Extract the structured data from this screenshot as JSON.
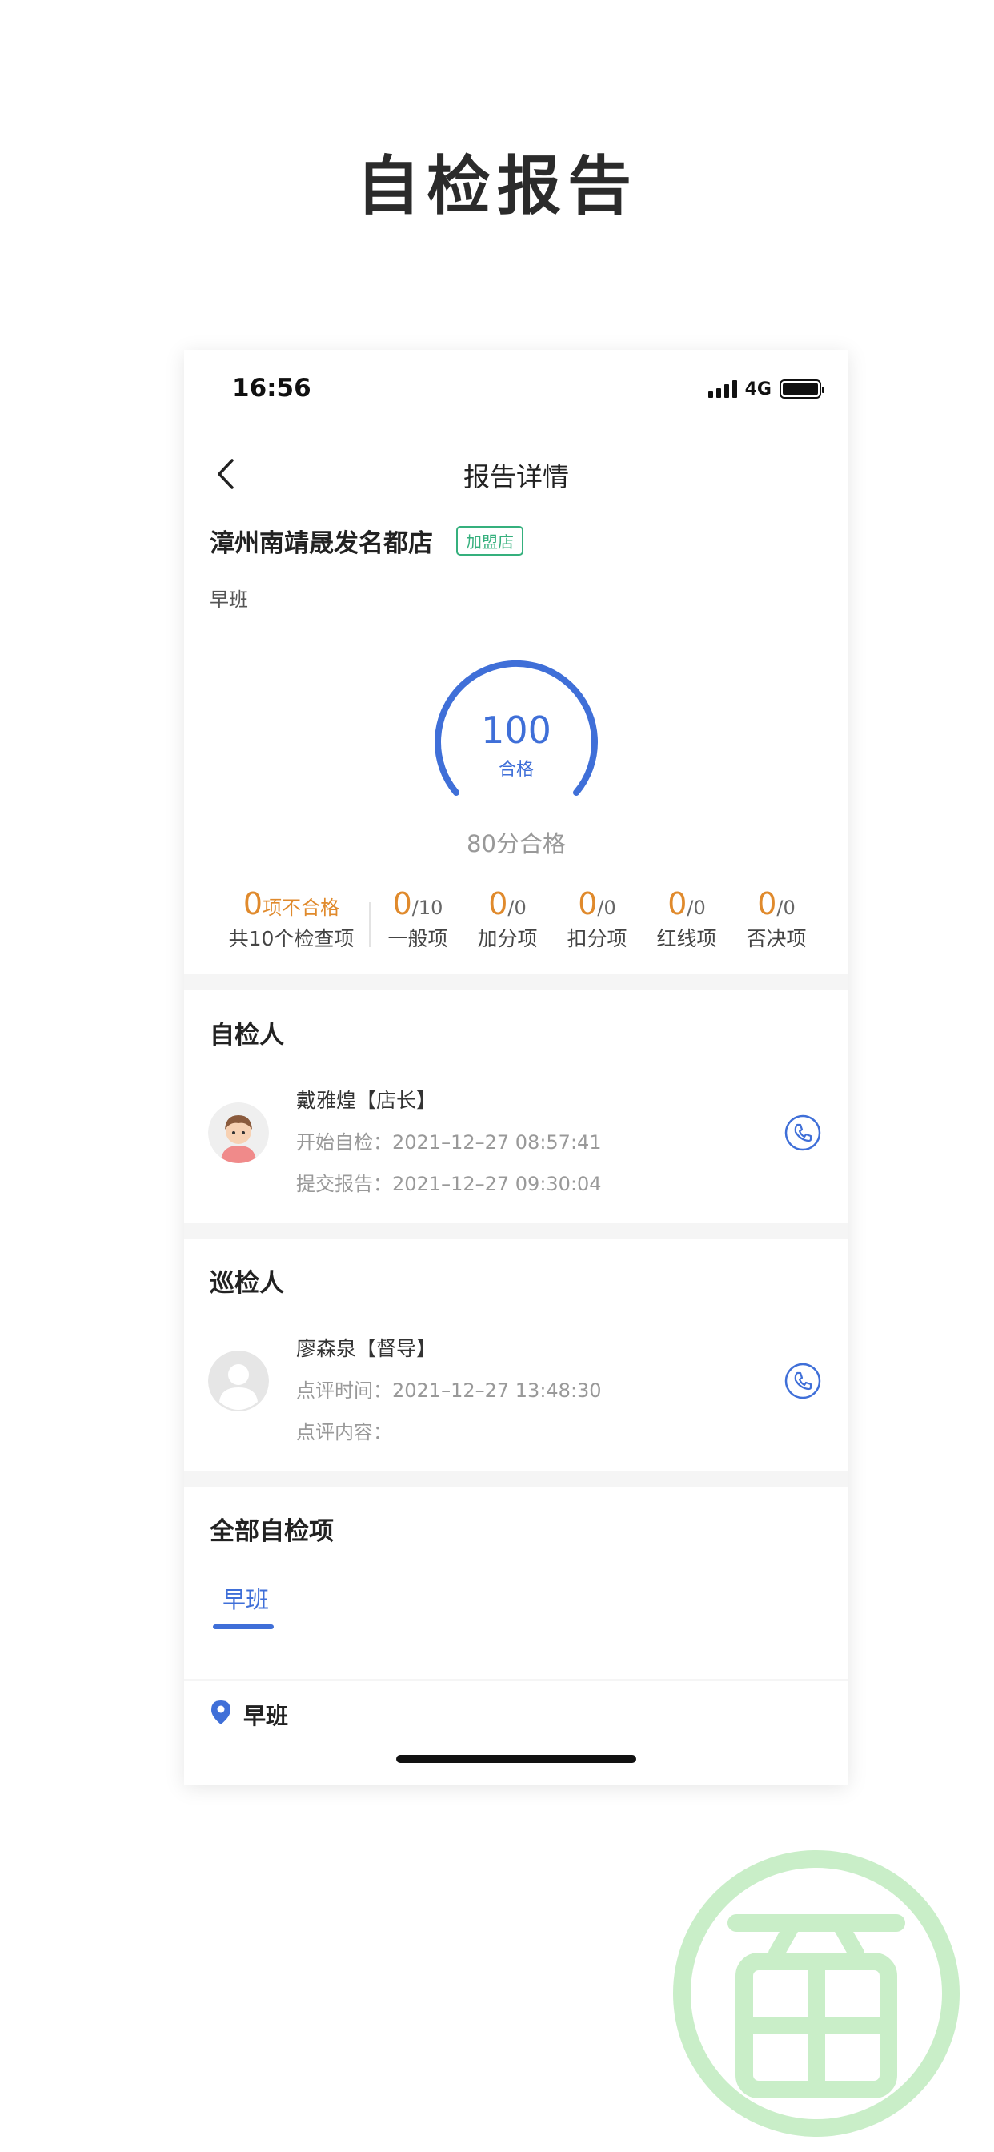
{
  "page": {
    "title": "自检报告"
  },
  "status_bar": {
    "time": "16:56",
    "network": "4G",
    "battery_level": 1.0
  },
  "nav": {
    "title": "报告详情",
    "back_icon": "chevron-left-icon"
  },
  "report": {
    "store_name": "漳州南靖晟发名都店",
    "store_tag": "加盟店",
    "shift": "早班",
    "score": "100",
    "score_status": "合格",
    "score_fraction": 1.0,
    "pass_threshold": "80分合格",
    "summary": {
      "fail_count": "0",
      "fail_label": "项不合格",
      "total_label": "共10个检查项"
    },
    "stats": [
      {
        "value": "0",
        "total": "/10",
        "label": "一般项"
      },
      {
        "value": "0",
        "total": "/0",
        "label": "加分项"
      },
      {
        "value": "0",
        "total": "/0",
        "label": "扣分项"
      },
      {
        "value": "0",
        "total": "/0",
        "label": "红线项"
      },
      {
        "value": "0",
        "total": "/0",
        "label": "否决项"
      }
    ]
  },
  "self_inspector": {
    "section_title": "自检人",
    "name": "戴雅煌【店长】",
    "start": "开始自检：2021–12–27 08:57:41",
    "submit": "提交报告：2021–12–27 09:30:04"
  },
  "patrol_inspector": {
    "section_title": "巡检人",
    "name": "廖森泉【督导】",
    "review_time": "点评时间：2021–12–27 13:48:30",
    "review_content": "点评内容："
  },
  "all_items": {
    "section_title": "全部自检项",
    "tabs": [
      {
        "label": "早班",
        "active": true
      }
    ],
    "group": "早班"
  },
  "colors": {
    "accent": "#3f6fd8",
    "orange": "#e08a2c",
    "tag_green": "#35b07d",
    "watermark": "#c9eec8"
  }
}
